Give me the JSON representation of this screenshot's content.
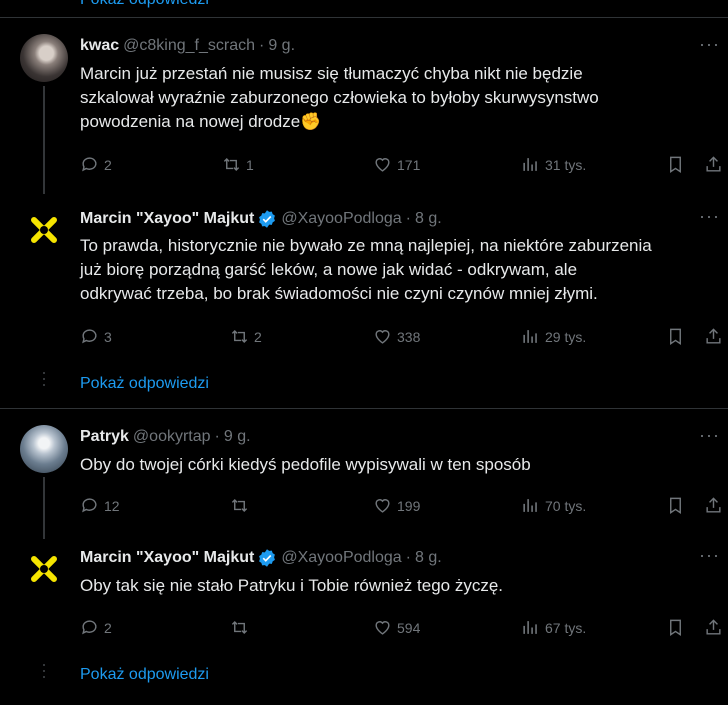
{
  "top_link": "Pokaż odpowiedzi",
  "threads": [
    {
      "reply": {
        "name": "kwac",
        "handle": "@c8king_f_scrach",
        "sep": "·",
        "time": "9 g.",
        "text_lines": [
          "Marcin już przestań nie musisz się tłumaczyć  chyba nikt nie będzie",
          "szkalował wyraźnie zaburzonego człowieka to byłoby skurwysynstwo",
          "powodzenia na nowej drodze✊"
        ],
        "replies": "2",
        "reposts": "1",
        "likes": "171",
        "views": "31 tys."
      },
      "answer": {
        "name": "Marcin \"Xayoo\" Majkut",
        "handle": "@XayooPodloga",
        "sep": "·",
        "time": "8 g.",
        "text_lines": [
          "To prawda, historycznie nie bywało ze mną najlepiej, na niektóre zaburzenia",
          "już biorę porządną garść leków, a nowe jak widać - odkrywam, ale",
          "odkrywać trzeba, bo brak świadomości nie czyni czynów mniej złymi."
        ],
        "replies": "3",
        "reposts": "2",
        "likes": "338",
        "views": "29 tys."
      },
      "show_replies": "Pokaż odpowiedzi"
    },
    {
      "reply": {
        "name": "Patryk",
        "handle": "@ookyrtap",
        "sep": "·",
        "time": "9 g.",
        "text_lines": [
          "Oby do twojej córki kiedyś pedofile wypisywali w ten sposób"
        ],
        "replies": "12",
        "reposts": "",
        "likes": "199",
        "views": "70 tys."
      },
      "answer": {
        "name": "Marcin \"Xayoo\" Majkut",
        "handle": "@XayooPodloga",
        "sep": "·",
        "time": "8 g.",
        "text_lines": [
          "Oby tak się nie stało Patryku i Tobie również tego życzę."
        ],
        "replies": "2",
        "reposts": "",
        "likes": "594",
        "views": "67 tys."
      },
      "show_replies": "Pokaż odpowiedzi"
    }
  ],
  "colors": {
    "accent": "#1d9bf0",
    "muted": "#71767b",
    "divider": "#2f3336",
    "xayoo_logo": "#f5e400"
  }
}
